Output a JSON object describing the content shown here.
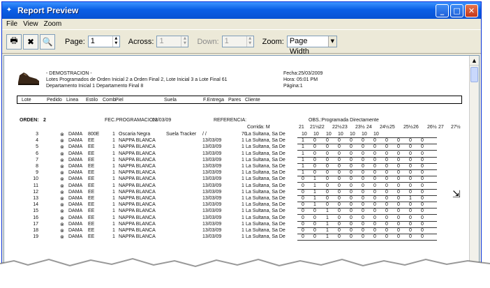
{
  "window": {
    "title": "Report Preview",
    "minimize": "_",
    "maximize": "□",
    "close": "✕"
  },
  "menu": [
    {
      "label": "File"
    },
    {
      "label": "View"
    },
    {
      "label": "Zoom"
    }
  ],
  "toolbar": {
    "print_icon": "print-icon",
    "close_icon": "close-report-icon",
    "search_icon": "magnify-icon",
    "page_label": "Page:",
    "page_value": "1",
    "across_label": "Across:",
    "across_value": "1",
    "down_label": "Down:",
    "down_value": "1",
    "zoom_label": "Zoom:",
    "zoom_value": "Page Width"
  },
  "report": {
    "header_left": [
      "- DEMOSTRACION -",
      "Lotes Programados de Orden Inicial 2 a Orden Final 2, Lote Inicial 3 a Lote Final 61",
      "Departamento Inicial 1 Departamento Final 8"
    ],
    "header_right": [
      "Fecha:25/03/2009",
      "Hora: 05:01 PM",
      "Página:1"
    ],
    "columns": [
      "Lote",
      "Pedido",
      "Linea",
      "Estilo",
      "Comb.",
      "Piel",
      "Suela",
      "F.Entrega",
      "Pares",
      "Cliente"
    ],
    "orden_label": "ORDEN:",
    "orden_value": "2",
    "fec_label": "FEC.PROGRAMACION:",
    "fec_value": "13/03/09",
    "ref_label": "REFERENCIA:",
    "obs_label": "OBS.:Programada Directamente",
    "corrida_label": "Corrida:",
    "corrida_value": "M",
    "sizes": [
      "21",
      "21½",
      "22",
      "22½",
      "23",
      "23½",
      "24",
      "24½",
      "25",
      "25½",
      "26",
      "26½",
      "27",
      "27½"
    ],
    "rows": [
      {
        "lote": "3",
        "icon": "⊗",
        "estilo": "DAMA",
        "comb": "800E",
        "num": "1",
        "piel": "Oscaria Negra",
        "suela": "Suela Tracker",
        "fecha": "/ /",
        "pares": "70",
        "cliente": "La Sultana, Sa De",
        "qty": [
          "10",
          "10",
          "10",
          "10",
          "10",
          "10",
          "10"
        ]
      },
      {
        "lote": "4",
        "icon": "⊗",
        "estilo": "DAMA",
        "comb": "EE",
        "num": "1",
        "piel": "NAPPA BLANCA",
        "suela": "",
        "fecha": "13/03/09",
        "pares": "1",
        "cliente": "La Sultana, Sa De",
        "qty": [
          "1",
          "0",
          "0",
          "0",
          "0",
          "0",
          "0",
          "0",
          "0",
          "0",
          "0"
        ]
      },
      {
        "lote": "5",
        "icon": "⊗",
        "estilo": "DAMA",
        "comb": "EE",
        "num": "1",
        "piel": "NAPPA BLANCA",
        "suela": "",
        "fecha": "13/03/09",
        "pares": "1",
        "cliente": "La Sultana, Sa De",
        "qty": [
          "1",
          "0",
          "0",
          "0",
          "0",
          "0",
          "0",
          "0",
          "0",
          "0",
          "0"
        ]
      },
      {
        "lote": "6",
        "icon": "⊗",
        "estilo": "DAMA",
        "comb": "EE",
        "num": "1",
        "piel": "NAPPA BLANCA",
        "suela": "",
        "fecha": "13/03/09",
        "pares": "1",
        "cliente": "La Sultana, Sa De",
        "qty": [
          "1",
          "0",
          "0",
          "0",
          "0",
          "0",
          "0",
          "0",
          "0",
          "0",
          "0"
        ]
      },
      {
        "lote": "7",
        "icon": "⊗",
        "estilo": "DAMA",
        "comb": "EE",
        "num": "1",
        "piel": "NAPPA BLANCA",
        "suela": "",
        "fecha": "13/03/09",
        "pares": "1",
        "cliente": "La Sultana, Sa De",
        "qty": [
          "1",
          "0",
          "0",
          "0",
          "0",
          "0",
          "0",
          "0",
          "0",
          "0",
          "0"
        ]
      },
      {
        "lote": "8",
        "icon": "⊗",
        "estilo": "DAMA",
        "comb": "EE",
        "num": "1",
        "piel": "NAPPA BLANCA",
        "suela": "",
        "fecha": "13/03/09",
        "pares": "1",
        "cliente": "La Sultana, Sa De",
        "qty": [
          "1",
          "0",
          "0",
          "0",
          "0",
          "0",
          "0",
          "0",
          "0",
          "0",
          "0"
        ]
      },
      {
        "lote": "9",
        "icon": "⊗",
        "estilo": "DAMA",
        "comb": "EE",
        "num": "1",
        "piel": "NAPPA BLANCA",
        "suela": "",
        "fecha": "13/03/09",
        "pares": "1",
        "cliente": "La Sultana, Sa De",
        "qty": [
          "1",
          "0",
          "0",
          "0",
          "0",
          "0",
          "0",
          "0",
          "0",
          "0",
          "0"
        ]
      },
      {
        "lote": "10",
        "icon": "⊗",
        "estilo": "DAMA",
        "comb": "EE",
        "num": "1",
        "piel": "NAPPA BLANCA",
        "suela": "",
        "fecha": "13/03/09",
        "pares": "1",
        "cliente": "La Sultana, Sa De",
        "qty": [
          "0",
          "1",
          "0",
          "0",
          "0",
          "0",
          "0",
          "0",
          "0",
          "0",
          "0"
        ]
      },
      {
        "lote": "11",
        "icon": "⊗",
        "estilo": "DAMA",
        "comb": "EE",
        "num": "1",
        "piel": "NAPPA BLANCA",
        "suela": "",
        "fecha": "13/03/09",
        "pares": "1",
        "cliente": "La Sultana, Sa De",
        "qty": [
          "0",
          "1",
          "0",
          "0",
          "0",
          "0",
          "0",
          "0",
          "0",
          "0",
          "0"
        ]
      },
      {
        "lote": "12",
        "icon": "⊗",
        "estilo": "DAMA",
        "comb": "EE",
        "num": "1",
        "piel": "NAPPA BLANCA",
        "suela": "",
        "fecha": "13/03/09",
        "pares": "1",
        "cliente": "La Sultana, Sa De",
        "qty": [
          "0",
          "1",
          "0",
          "0",
          "0",
          "0",
          "0",
          "0",
          "0",
          "0",
          "0"
        ]
      },
      {
        "lote": "13",
        "icon": "⊗",
        "estilo": "DAMA",
        "comb": "EE",
        "num": "1",
        "piel": "NAPPA BLANCA",
        "suela": "",
        "fecha": "13/03/09",
        "pares": "1",
        "cliente": "La Sultana, Sa De",
        "qty": [
          "0",
          "1",
          "0",
          "0",
          "0",
          "0",
          "0",
          "0",
          "0",
          "1",
          "0"
        ]
      },
      {
        "lote": "14",
        "icon": "⊗",
        "estilo": "DAMA",
        "comb": "EE",
        "num": "1",
        "piel": "NAPPA BLANCA",
        "suela": "",
        "fecha": "13/03/09",
        "pares": "1",
        "cliente": "La Sultana, Sa De",
        "qty": [
          "0",
          "1",
          "0",
          "0",
          "0",
          "0",
          "0",
          "0",
          "0",
          "0",
          "0"
        ]
      },
      {
        "lote": "15",
        "icon": "⊗",
        "estilo": "DAMA",
        "comb": "EE",
        "num": "1",
        "piel": "NAPPA BLANCA",
        "suela": "",
        "fecha": "13/03/09",
        "pares": "1",
        "cliente": "La Sultana, Sa De",
        "qty": [
          "0",
          "0",
          "1",
          "0",
          "0",
          "0",
          "0",
          "0",
          "0",
          "0",
          "0"
        ]
      },
      {
        "lote": "16",
        "icon": "⊗",
        "estilo": "DAMA",
        "comb": "EE",
        "num": "1",
        "piel": "NAPPA BLANCA",
        "suela": "",
        "fecha": "13/03/09",
        "pares": "1",
        "cliente": "La Sultana, Sa De",
        "qty": [
          "0",
          "0",
          "1",
          "0",
          "0",
          "0",
          "0",
          "0",
          "0",
          "0",
          "0"
        ]
      },
      {
        "lote": "17",
        "icon": "⊗",
        "estilo": "DAMA",
        "comb": "EE",
        "num": "1",
        "piel": "NAPPA BLANCA",
        "suela": "",
        "fecha": "13/03/09",
        "pares": "1",
        "cliente": "La Sultana, Sa De",
        "qty": [
          "0",
          "0",
          "1",
          "0",
          "0",
          "0",
          "0",
          "0",
          "0",
          "0",
          "0"
        ]
      },
      {
        "lote": "18",
        "icon": "⊗",
        "estilo": "DAMA",
        "comb": "EE",
        "num": "1",
        "piel": "NAPPA BLANCA",
        "suela": "",
        "fecha": "13/03/09",
        "pares": "1",
        "cliente": "La Sultana, Sa De",
        "qty": [
          "0",
          "0",
          "1",
          "0",
          "0",
          "0",
          "0",
          "0",
          "0",
          "0",
          "0"
        ]
      },
      {
        "lote": "19",
        "icon": "⊗",
        "estilo": "DAMA",
        "comb": "EE",
        "num": "1",
        "piel": "NAPPA BLANCA",
        "suela": "",
        "fecha": "13/03/09",
        "pares": "1",
        "cliente": "La Sultana, Sa De",
        "qty": [
          "0",
          "0",
          "1",
          "0",
          "0",
          "0",
          "0",
          "0",
          "0",
          "0",
          "0"
        ]
      }
    ]
  },
  "colors": {
    "titlebar": "#0a5fe6",
    "window_bg": "#ece9d8"
  }
}
